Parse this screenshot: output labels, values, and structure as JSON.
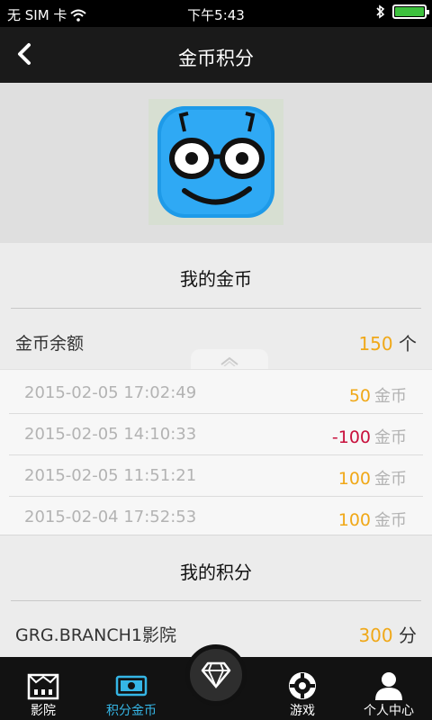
{
  "status_bar": {
    "carrier": "无 SIM 卡",
    "time": "下午5:43",
    "battery_level": 1.0,
    "icons": [
      "wifi-icon",
      "bluetooth-icon",
      "battery-icon"
    ]
  },
  "nav": {
    "title": "金币积分",
    "back_icon": "chevron-left-icon"
  },
  "header": {
    "avatar_icon": "cartoon-face-icon"
  },
  "coins": {
    "title": "我的金币",
    "balance_label": "金币余额",
    "balance_value": "150",
    "balance_unit": "个",
    "history": [
      {
        "date": "2015-02-05 17:02:49",
        "amount": "50",
        "unit": "金币",
        "color": "#f0a818"
      },
      {
        "date": "2015-02-05 14:10:33",
        "amount": "-100",
        "unit": "金币",
        "color": "#c8103c"
      },
      {
        "date": "2015-02-05 11:51:21",
        "amount": "100",
        "unit": "金币",
        "color": "#f0a818"
      },
      {
        "date": "2015-02-04 17:52:53",
        "amount": "100",
        "unit": "金币",
        "color": "#f0a818"
      }
    ]
  },
  "points": {
    "title": "我的积分",
    "cinema_label": "GRG.BRANCH1影院",
    "points_value": "300",
    "points_unit": "分"
  },
  "tabs": [
    {
      "label": "影院",
      "icon": "cinema-icon",
      "active": false
    },
    {
      "label": "积分金币",
      "icon": "money-icon",
      "active": true
    },
    {
      "label": "",
      "icon": "diamond-icon",
      "active": false
    },
    {
      "label": "游戏",
      "icon": "gamepad-icon",
      "active": false
    },
    {
      "label": "个人中心",
      "icon": "user-icon",
      "active": false
    }
  ],
  "colors": {
    "accent_gold": "#f0a818",
    "negative_red": "#c8103c",
    "tab_active": "#35b6e6"
  }
}
